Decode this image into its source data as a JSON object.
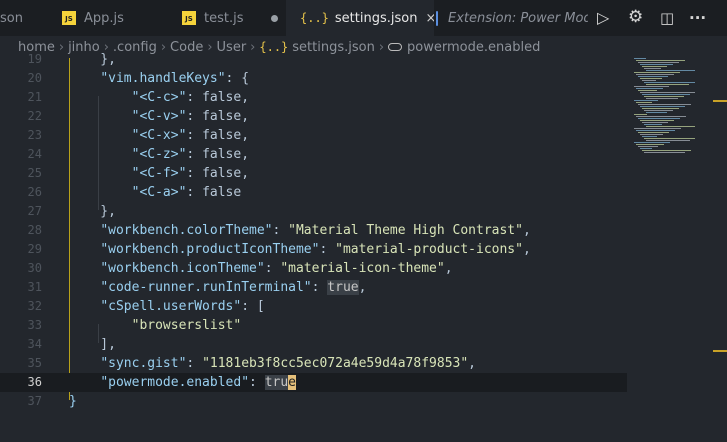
{
  "tabs": [
    {
      "label": "son",
      "icon": "none"
    },
    {
      "label": "App.js",
      "icon": "js-icon",
      "badge": "JS"
    },
    {
      "label": "test.js",
      "icon": "js-icon",
      "badge": "JS",
      "modified": true
    },
    {
      "label": "settings.json",
      "icon": "json-icon",
      "glyph": "{..}",
      "active": true
    },
    {
      "label": "Extension: Power Mode",
      "icon": "extension-page-icon"
    }
  ],
  "toolbar": {
    "run_icon": "▷",
    "settings_icon": "⚙",
    "split_icon": "◫",
    "more_icon": "···",
    "close_icon": "×"
  },
  "breadcrumb": {
    "parts": [
      "home",
      "jinho",
      ".config",
      "Code",
      "User"
    ],
    "file": "settings.json",
    "file_glyph": "{..}",
    "symbol": "powermode.enabled",
    "sep": "›"
  },
  "editor": {
    "line_numbers": [
      "19",
      "20",
      "21",
      "22",
      "23",
      "24",
      "25",
      "26",
      "27",
      "28",
      "29",
      "30",
      "31",
      "32",
      "33",
      "34",
      "35",
      "36",
      "37"
    ],
    "current_line": "36",
    "lines": [
      [
        {
          "t": "    },",
          "c": "p"
        }
      ],
      [
        {
          "t": "    ",
          "c": "p"
        },
        {
          "t": "\"vim.handleKeys\"",
          "c": "k"
        },
        {
          "t": ": {",
          "c": "p"
        }
      ],
      [
        {
          "t": "        ",
          "c": "p"
        },
        {
          "t": "\"<C-c>\"",
          "c": "k"
        },
        {
          "t": ": false,",
          "c": "p"
        }
      ],
      [
        {
          "t": "        ",
          "c": "p"
        },
        {
          "t": "\"<C-v>\"",
          "c": "k"
        },
        {
          "t": ": false,",
          "c": "p"
        }
      ],
      [
        {
          "t": "        ",
          "c": "p"
        },
        {
          "t": "\"<C-x>\"",
          "c": "k"
        },
        {
          "t": ": false,",
          "c": "p"
        }
      ],
      [
        {
          "t": "        ",
          "c": "p"
        },
        {
          "t": "\"<C-z>\"",
          "c": "k"
        },
        {
          "t": ": false,",
          "c": "p"
        }
      ],
      [
        {
          "t": "        ",
          "c": "p"
        },
        {
          "t": "\"<C-f>\"",
          "c": "k"
        },
        {
          "t": ": false,",
          "c": "p"
        }
      ],
      [
        {
          "t": "        ",
          "c": "p"
        },
        {
          "t": "\"<C-a>\"",
          "c": "k"
        },
        {
          "t": ": false",
          "c": "p"
        }
      ],
      [
        {
          "t": "    },",
          "c": "p"
        }
      ],
      [
        {
          "t": "    ",
          "c": "p"
        },
        {
          "t": "\"workbench.colorTheme\"",
          "c": "k"
        },
        {
          "t": ": ",
          "c": "p"
        },
        {
          "t": "\"Material Theme High Contrast\"",
          "c": "s"
        },
        {
          "t": ",",
          "c": "p"
        }
      ],
      [
        {
          "t": "    ",
          "c": "p"
        },
        {
          "t": "\"workbench.productIconTheme\"",
          "c": "k"
        },
        {
          "t": ": ",
          "c": "p"
        },
        {
          "t": "\"material-product-icons\"",
          "c": "s"
        },
        {
          "t": ",",
          "c": "p"
        }
      ],
      [
        {
          "t": "    ",
          "c": "p"
        },
        {
          "t": "\"workbench.iconTheme\"",
          "c": "k"
        },
        {
          "t": ": ",
          "c": "p"
        },
        {
          "t": "\"material-icon-theme\"",
          "c": "s"
        },
        {
          "t": ",",
          "c": "p"
        }
      ],
      [
        {
          "t": "    ",
          "c": "p"
        },
        {
          "t": "\"code-runner.runInTerminal\"",
          "c": "k"
        },
        {
          "t": ": ",
          "c": "p"
        },
        {
          "t": "true",
          "c": "hl"
        },
        {
          "t": ",",
          "c": "p"
        }
      ],
      [
        {
          "t": "    ",
          "c": "p"
        },
        {
          "t": "\"cSpell.userWords\"",
          "c": "k"
        },
        {
          "t": ": [",
          "c": "p"
        }
      ],
      [
        {
          "t": "        ",
          "c": "p"
        },
        {
          "t": "\"browserslist\"",
          "c": "s"
        }
      ],
      [
        {
          "t": "    ],",
          "c": "p"
        }
      ],
      [
        {
          "t": "    ",
          "c": "p"
        },
        {
          "t": "\"sync.gist\"",
          "c": "k"
        },
        {
          "t": ": ",
          "c": "p"
        },
        {
          "t": "\"1181eb3f8cc5ec072a4e59d4a78f9853\"",
          "c": "s"
        },
        {
          "t": ",",
          "c": "p"
        }
      ],
      [
        {
          "t": "    ",
          "c": "p"
        },
        {
          "t": "\"powermode.enabled\"",
          "c": "k"
        },
        {
          "t": ": ",
          "c": "p"
        },
        {
          "t": "tru",
          "c": "hl"
        },
        {
          "t": "e",
          "c": "cursorch"
        }
      ],
      [
        {
          "t": "}",
          "c": "b"
        }
      ]
    ]
  },
  "colors": {
    "accent_yellow": "#e6c34a",
    "background": "#23272d",
    "key": "#9ad0f0",
    "string": "#d8e4b8"
  }
}
